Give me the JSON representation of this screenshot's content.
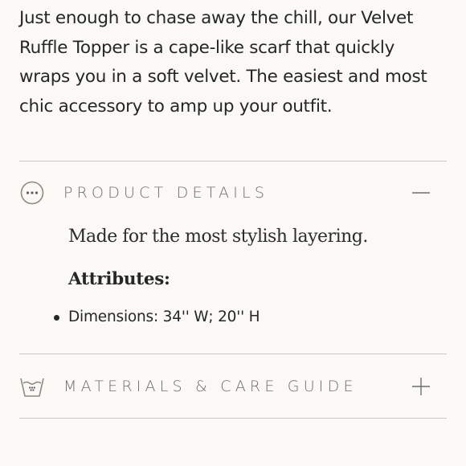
{
  "intro": {
    "text": "Just enough to chase away the chill, our Velvet Ruffle Topper is a cape-like scarf that quickly wraps you in a soft velvet. The easiest and most chic accessory to amp up your outfit."
  },
  "sections": [
    {
      "title": "PRODUCT DETAILS",
      "icon": "ellipsis-circle-icon",
      "toggle": "minus-icon",
      "expanded": true,
      "body": {
        "lead": "Made for the most stylish layering.",
        "attributes_heading": "Attributes:",
        "attributes": [
          "Dimensions: 34'' W; 20'' H"
        ]
      }
    },
    {
      "title": "MATERIALS & CARE GUIDE",
      "icon": "wash-basin-icon",
      "toggle": "plus-icon",
      "expanded": false
    }
  ],
  "colors": {
    "background": "#faf9f6",
    "text": "#262626",
    "muted": "#6e6e6e",
    "divider": "#c9c8c3",
    "icon": "#8a8a80"
  }
}
